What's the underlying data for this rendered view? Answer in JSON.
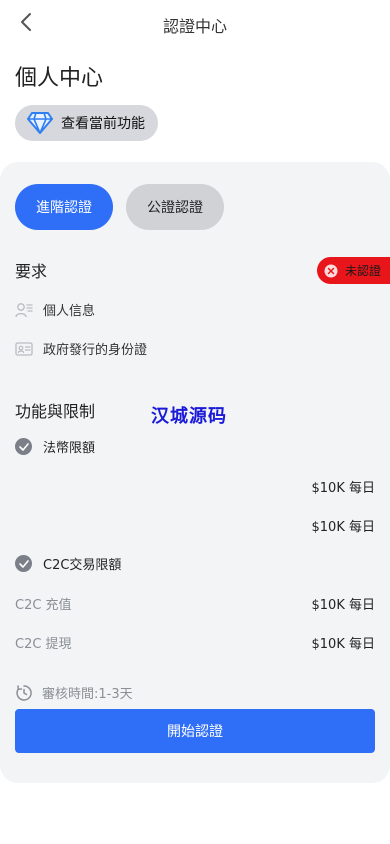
{
  "nav": {
    "title": "認證中心"
  },
  "page": {
    "title": "個人中心"
  },
  "features_chip": {
    "label": "查看當前功能"
  },
  "tabs": [
    {
      "label": "進階認證",
      "active": true
    },
    {
      "label": "公證認證",
      "active": false
    }
  ],
  "requirements": {
    "title": "要求",
    "status": "未認證",
    "items": [
      {
        "icon": "person-id-icon",
        "label": "個人信息"
      },
      {
        "icon": "id-card-icon",
        "label": "政府發行的身份證"
      }
    ]
  },
  "watermark": "汉城源码",
  "features": {
    "title": "功能與限制",
    "fiat": {
      "label": "法幣限額",
      "values": [
        "$10K 每日",
        "$10K 每日"
      ]
    },
    "c2c": {
      "label": "C2C交易限額",
      "rows": [
        {
          "label": "C2C 充值",
          "value": "$10K 每日"
        },
        {
          "label": "C2C 提現",
          "value": "$10K 每日"
        }
      ]
    }
  },
  "review": {
    "text": "審核時間:1-3天"
  },
  "cta": {
    "label": "開始認證"
  },
  "colors": {
    "accent": "#2f6ef7",
    "status_error": "#e8151b",
    "card_bg": "#f3f4f6"
  }
}
